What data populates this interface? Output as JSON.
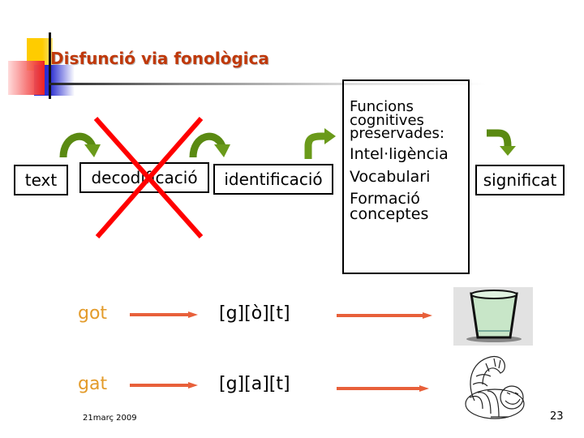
{
  "slide": {
    "title": "Disfunció via fonològica",
    "page_number": "23",
    "date": "21març 2009"
  },
  "process": {
    "text_label": "text",
    "decoding_label": "decodificació",
    "identification_label": "identificació",
    "meaning_label": "significat",
    "cognitive_box": {
      "heading_line1": "Funcions",
      "heading_line2": "cognitives",
      "heading_line3": "preservades:",
      "items": [
        "Intel·ligència",
        "Vocabulari",
        "Formació",
        "conceptes"
      ]
    },
    "blocked_step": "decodificació"
  },
  "examples": [
    {
      "word": "got",
      "phonemes": "[g][ò][t]",
      "image": "glass-image"
    },
    {
      "word": "gat",
      "phonemes": "[g][a][t]",
      "image": "cat-image"
    }
  ],
  "colors": {
    "title": "#c0390b",
    "arrow_green": "#5a8a12",
    "cross_red": "#ff0000",
    "example_arrow": "#e8603a",
    "example_word": "#e39b2a"
  }
}
